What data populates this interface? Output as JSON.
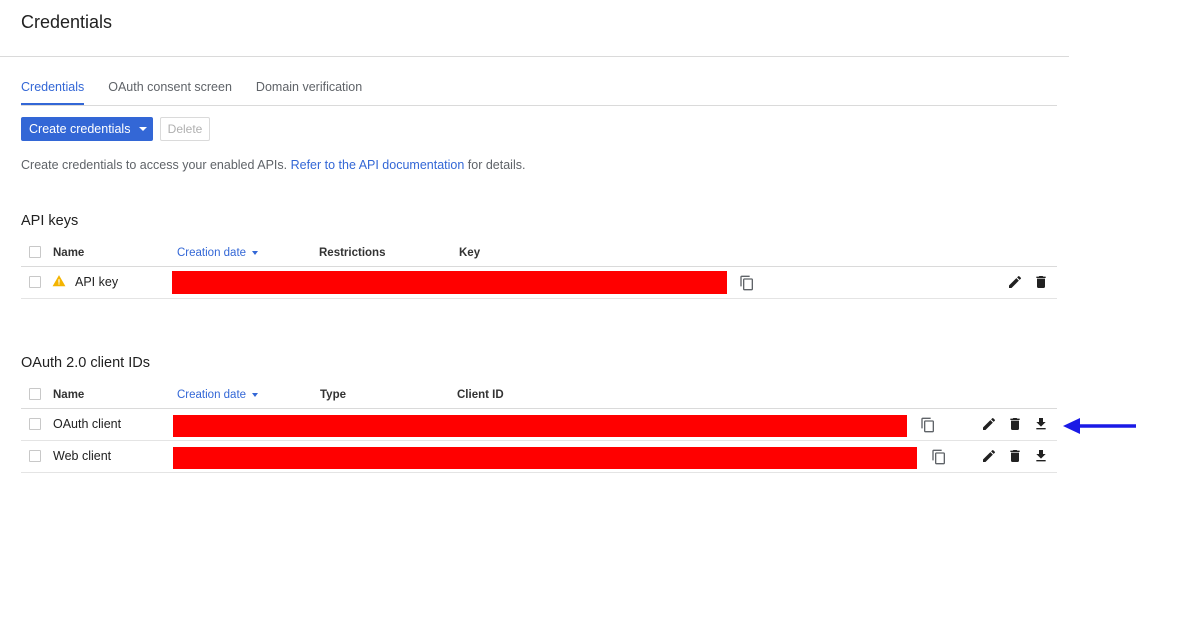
{
  "page": {
    "title": "Credentials"
  },
  "tabs": [
    {
      "label": "Credentials",
      "active": true
    },
    {
      "label": "OAuth consent screen",
      "active": false
    },
    {
      "label": "Domain verification",
      "active": false
    }
  ],
  "toolbar": {
    "create_label": "Create credentials",
    "delete_label": "Delete"
  },
  "description": {
    "before": "Create credentials to access your enabled APIs. ",
    "link": "Refer to the API documentation",
    "after": " for details."
  },
  "api_keys": {
    "title": "API keys",
    "columns": [
      "Name",
      "Creation date",
      "Restrictions",
      "Key"
    ],
    "rows": [
      {
        "name": "API key",
        "status_icon": "warning-icon"
      }
    ]
  },
  "oauth": {
    "title": "OAuth 2.0 client IDs",
    "columns": [
      "Name",
      "Creation date",
      "Type",
      "Client ID"
    ],
    "rows": [
      {
        "name": "OAuth client"
      },
      {
        "name": "Web client"
      }
    ]
  },
  "colors": {
    "accent": "#3367d6",
    "redaction": "#ff0000",
    "warning": "#f4b400",
    "annotation_arrow": "#1a1ae6"
  },
  "icons": [
    "copy-icon",
    "edit-icon",
    "delete-icon",
    "download-icon",
    "sort-down-icon",
    "dropdown-caret-icon"
  ]
}
